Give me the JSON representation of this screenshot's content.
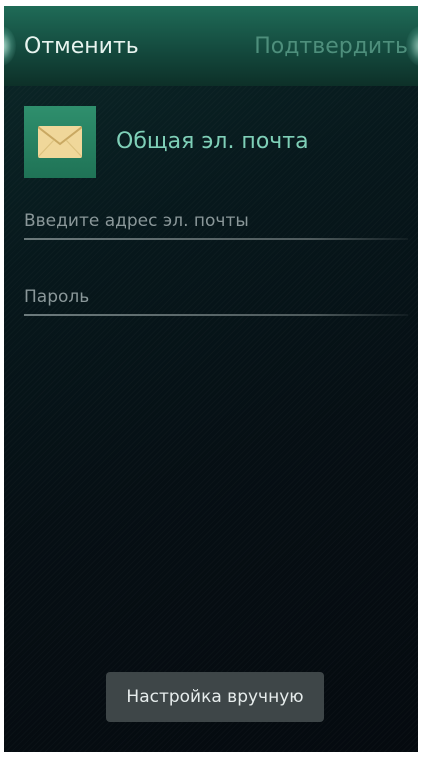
{
  "header": {
    "cancel_label": "Отменить",
    "confirm_label": "Подтвердить"
  },
  "account": {
    "icon": "mail-envelope-icon",
    "title": "Общая эл. почта"
  },
  "form": {
    "email": {
      "value": "",
      "placeholder": "Введите адрес эл. почты"
    },
    "password": {
      "value": "",
      "placeholder": "Пароль"
    }
  },
  "footer": {
    "manual_setup_label": "Настройка вручную"
  },
  "colors": {
    "header_green": "#1f6b57",
    "accent_text": "#7fd0b8",
    "disabled_text": "#4e8f7c",
    "icon_bg": "#2f8f6d",
    "envelope": "#f0d79a",
    "button_bg": "#3e4648"
  }
}
